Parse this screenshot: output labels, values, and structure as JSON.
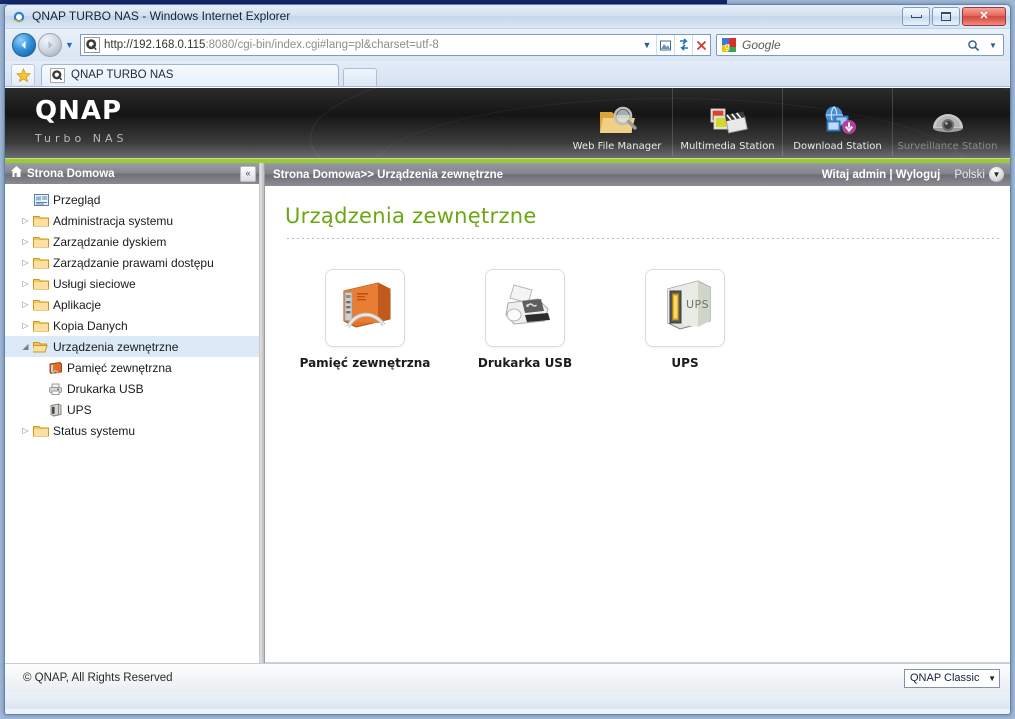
{
  "browser": {
    "window_title": "QNAP TURBO NAS - Windows Internet Explorer",
    "window_controls": {
      "minimize": "Minimize",
      "maximize": "Maximize",
      "close": "Close"
    },
    "address": {
      "url_scheme": "http://192.168.0.115",
      "url_rest": ":8080/cgi-bin/index.cgi#lang=pl&charset=utf-8",
      "full_url": "http://192.168.0.115:8080/cgi-bin/index.cgi#lang=pl&charset=utf-8"
    },
    "search": {
      "placeholder": "Google",
      "value": "Google"
    },
    "tabs": [
      {
        "label": "QNAP TURBO NAS"
      }
    ],
    "new_tab_label": ""
  },
  "qnap_header": {
    "brand": "QNAP",
    "brand_sub": "Turbo NAS",
    "apps": [
      {
        "label": "Web File Manager",
        "icon": "folder-search-icon",
        "disabled": false
      },
      {
        "label": "Multimedia Station",
        "icon": "photos-clapper-icon",
        "disabled": false
      },
      {
        "label": "Download Station",
        "icon": "download-monitor-icon",
        "disabled": false
      },
      {
        "label": "Surveillance Station",
        "icon": "dome-camera-icon",
        "disabled": true
      }
    ],
    "accent_green": "#9cc93a"
  },
  "sidebar": {
    "header_title": "Strona Domowa",
    "header_icon": "home-icon",
    "collapse_icon": "«",
    "items": [
      {
        "label": "Przegląd",
        "icon": "overview-icon",
        "type": "leaf",
        "twisty": "",
        "selected": false
      },
      {
        "label": "Administracja systemu",
        "icon": "folder-icon",
        "type": "folder",
        "twisty": "▷",
        "selected": false
      },
      {
        "label": "Zarządzanie dyskiem",
        "icon": "folder-icon",
        "type": "folder",
        "twisty": "▷",
        "selected": false
      },
      {
        "label": "Zarządzanie prawami dostępu",
        "icon": "folder-icon",
        "type": "folder",
        "twisty": "▷",
        "selected": false
      },
      {
        "label": "Usługi sieciowe",
        "icon": "folder-icon",
        "type": "folder",
        "twisty": "▷",
        "selected": false
      },
      {
        "label": "Aplikacje",
        "icon": "folder-icon",
        "type": "folder",
        "twisty": "▷",
        "selected": false
      },
      {
        "label": "Kopia Danych",
        "icon": "folder-icon",
        "type": "folder",
        "twisty": "▷",
        "selected": false
      },
      {
        "label": "Urządzenia zewnętrzne",
        "icon": "folder-open-icon",
        "type": "folder",
        "twisty": "◢",
        "selected": true
      },
      {
        "label": "Pamięć zewnętrzna",
        "icon": "external-storage-icon",
        "type": "child",
        "twisty": "",
        "selected": false
      },
      {
        "label": "Drukarka USB",
        "icon": "usb-printer-icon",
        "type": "child",
        "twisty": "",
        "selected": false
      },
      {
        "label": "UPS",
        "icon": "ups-icon",
        "type": "child",
        "twisty": "",
        "selected": false
      },
      {
        "label": "Status systemu",
        "icon": "folder-icon",
        "type": "folder",
        "twisty": "▷",
        "selected": false
      }
    ]
  },
  "crumbbar": {
    "breadcrumb": "Strona Domowa>> Urządzenia zewnętrzne",
    "welcome": "Witaj admin | Wyloguj",
    "language": "Polski",
    "language_caret_icon": "chevron-down-icon"
  },
  "main": {
    "page_title": "Urządzenia zewnętrzne",
    "devices": [
      {
        "label": "Pamięć zewnętrzna",
        "icon": "external-hdd-icon"
      },
      {
        "label": "Drukarka USB",
        "icon": "printer-icon"
      },
      {
        "label": "UPS",
        "icon": "ups-tower-icon"
      }
    ]
  },
  "footer": {
    "copyright": "© QNAP, All Rights Reserved",
    "theme": "QNAP Classic",
    "theme_caret_icon": "caret-down-icon"
  }
}
